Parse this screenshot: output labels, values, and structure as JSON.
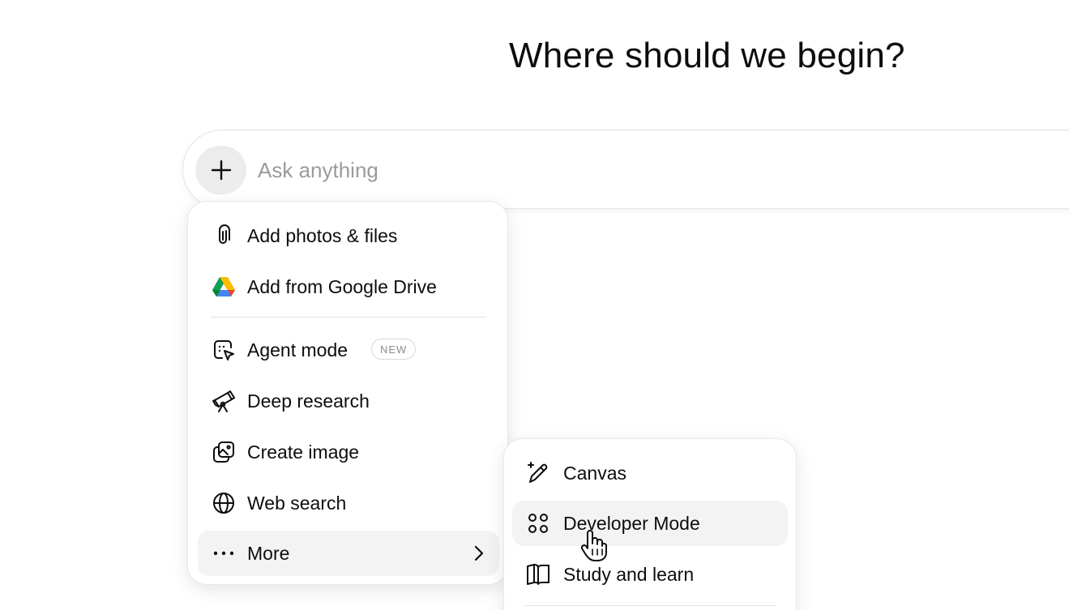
{
  "header": {
    "title": "Where should we begin?"
  },
  "composer": {
    "placeholder": "Ask anything",
    "add_icon": "plus-icon"
  },
  "menu": {
    "items": [
      {
        "label": "Add photos & files",
        "icon": "paperclip-icon"
      },
      {
        "label": "Add from Google Drive",
        "icon": "google-drive-icon"
      },
      {
        "label": "Agent mode",
        "icon": "agent-mode-icon",
        "badge": "NEW"
      },
      {
        "label": "Deep research",
        "icon": "telescope-icon"
      },
      {
        "label": "Create image",
        "icon": "image-icon"
      },
      {
        "label": "Web search",
        "icon": "globe-icon"
      },
      {
        "label": "More",
        "icon": "ellipsis-icon",
        "has_submenu": true
      }
    ]
  },
  "submenu": {
    "items": [
      {
        "label": "Canvas",
        "icon": "pencil-sparkle-icon"
      },
      {
        "label": "Developer Mode",
        "icon": "developer-nodes-icon"
      },
      {
        "label": "Study and learn",
        "icon": "book-icon"
      }
    ]
  },
  "colors": {
    "background": "#ffffff",
    "text": "#0d0d0d",
    "placeholder": "#9b9b9b",
    "hover": "#f3f3f3",
    "plus_button_bg": "#ececec"
  }
}
